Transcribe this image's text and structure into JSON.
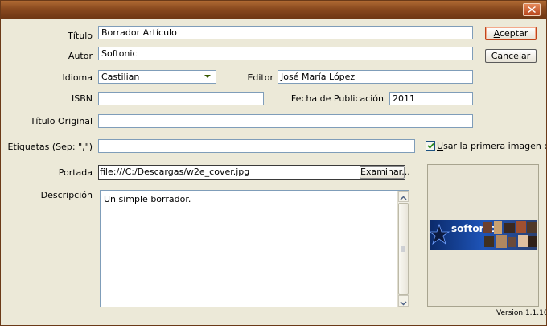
{
  "titlebar": {
    "close_icon": "close-icon"
  },
  "form": {
    "titulo": {
      "label": "Título",
      "value": "Borrador Artículo"
    },
    "autor": {
      "label_prefix": "A",
      "label_rest": "utor",
      "value": "Softonic"
    },
    "idioma": {
      "label": "Idioma",
      "value": "Castilian"
    },
    "editor": {
      "label": "Editor",
      "value": "José María López"
    },
    "isbn": {
      "label": "ISBN",
      "value": ""
    },
    "fecha": {
      "label": "Fecha de Publicación",
      "value": "2011"
    },
    "titulo_original": {
      "label": "Título Original",
      "value": ""
    },
    "etiquetas": {
      "label_prefix": "E",
      "label_rest": "tiquetas (Sep: \",\")",
      "value": ""
    },
    "usar_imagen": {
      "label_prefix": "U",
      "label_rest": "sar la primera imagen com",
      "checked": true
    },
    "portada": {
      "label": "Portada",
      "value": "file:///C:/Descargas/w2e_cover.jpg",
      "browse_label": "Examinar..."
    },
    "descripcion": {
      "label": "Descripción",
      "value": "Un simple borrador."
    }
  },
  "buttons": {
    "aceptar_prefix": "A",
    "aceptar_rest": "ceptar",
    "cancelar": "Cancelar"
  },
  "preview": {
    "banner_text": "softonic"
  },
  "version": "Version 1.1.10",
  "colors": {
    "accent": "#c0441b",
    "titlebar": "#8a4a1f",
    "background": "#ece9d8"
  }
}
